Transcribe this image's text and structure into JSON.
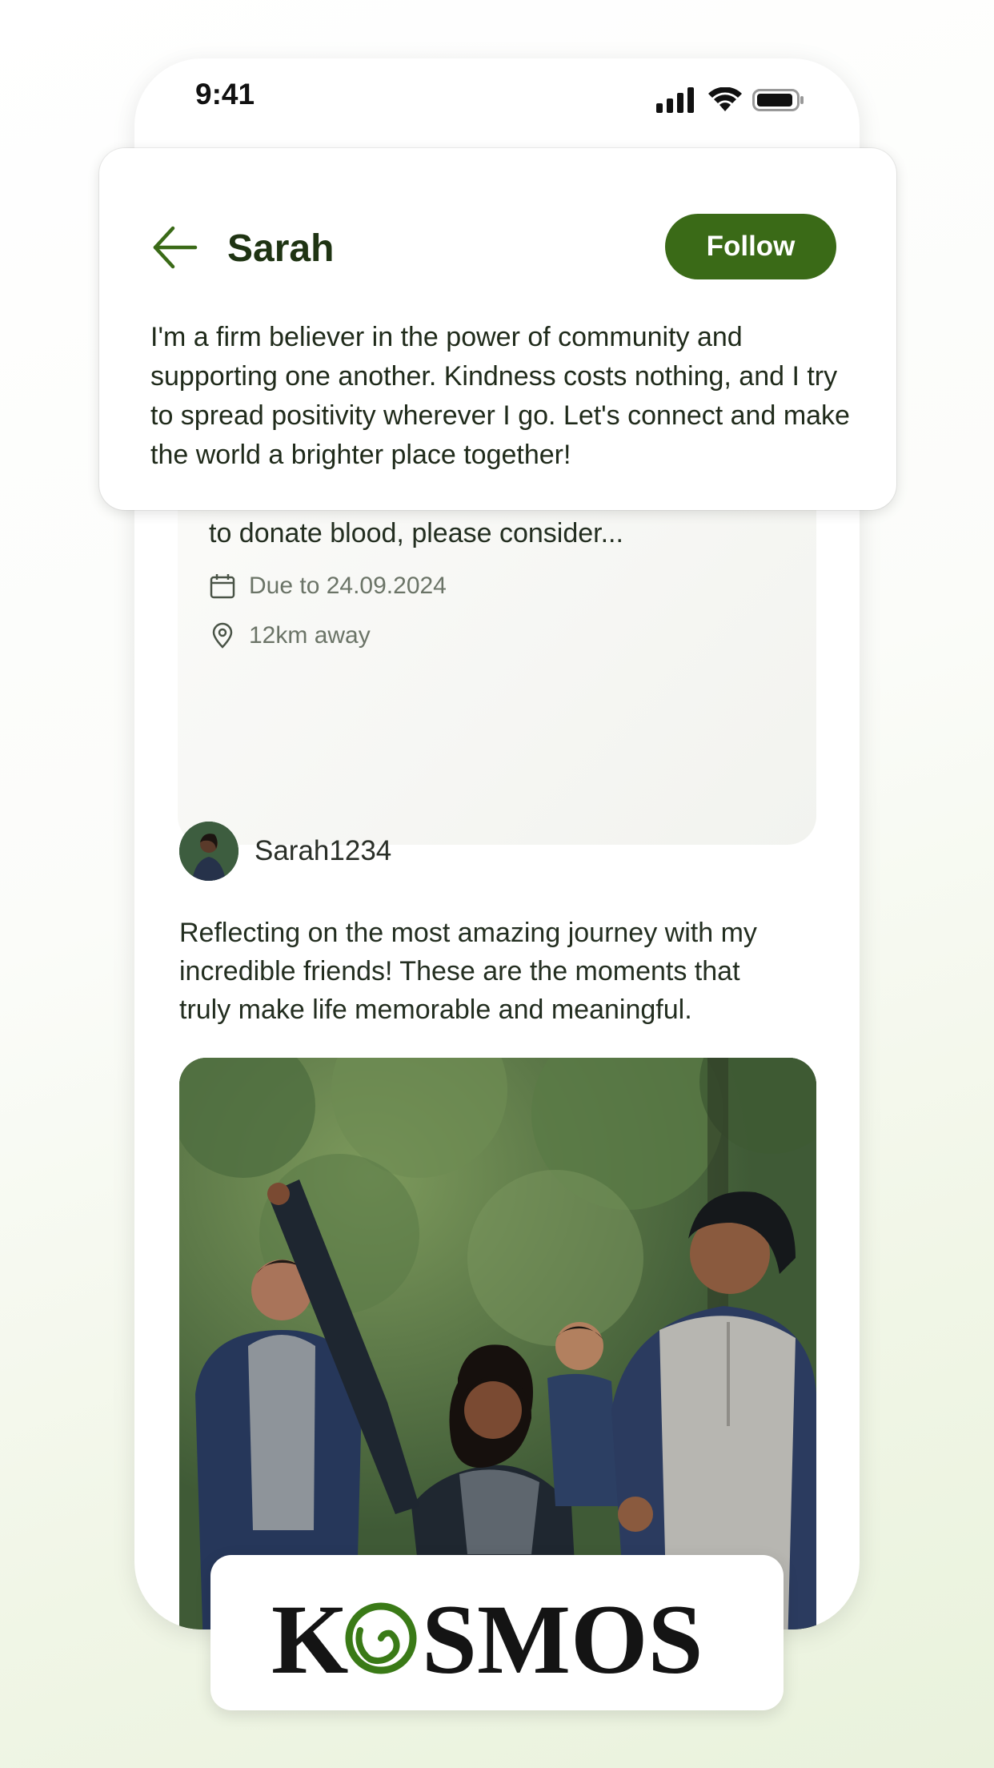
{
  "status_bar": {
    "time": "9:41"
  },
  "profile": {
    "name": "Sarah",
    "follow_label": "Follow",
    "bio": "I'm a firm believer in the power of community and supporting one another. Kindness costs nothing, and I try to spread positivity wherever I go. Let's connect and make the world a brighter place together!"
  },
  "request_post": {
    "type": "blood request",
    "text": "If you or someone you know is eligible and able to donate blood, please consider...",
    "due": "Due to 24.09.2024",
    "distance": "12km away"
  },
  "feed_post": {
    "author": "Sarah1234",
    "caption": "Reflecting on the most amazing journey with my incredible friends! These are the moments that truly make life memorable and meaningful."
  },
  "logo": {
    "text": "KOSMOS",
    "brand_color": "#3a7a17"
  },
  "colors": {
    "accent": "#3a6a17",
    "name_text": "#1f3413",
    "icon_green": "#3a6a17"
  }
}
